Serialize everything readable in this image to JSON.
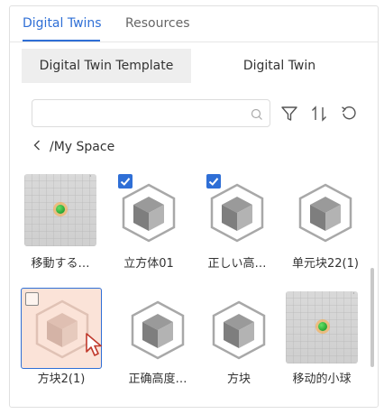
{
  "tabs": [
    {
      "label": "Digital Twins",
      "active": true
    },
    {
      "label": "Resources",
      "active": false
    }
  ],
  "segments": [
    {
      "label": "Digital Twin Template",
      "active": true
    },
    {
      "label": "Digital Twin",
      "active": false
    }
  ],
  "search": {
    "value": "",
    "placeholder": ""
  },
  "toolbar": {
    "icons": [
      "filter-icon",
      "sort-icon",
      "refresh-icon"
    ]
  },
  "breadcrumb": {
    "path": "/My Space"
  },
  "items": [
    {
      "label": "移動する…",
      "thumbnail": "sphere-scene",
      "checked": false
    },
    {
      "label": "立方体01",
      "thumbnail": "cube-icon",
      "checked": true
    },
    {
      "label": "正しい高…",
      "thumbnail": "cube-icon",
      "checked": true
    },
    {
      "label": "单元块22(1)",
      "thumbnail": "cube-icon",
      "checked": false
    },
    {
      "label": "方块2(1)",
      "thumbnail": "cube-icon",
      "checked": false,
      "selected": true
    },
    {
      "label": "正确高度…",
      "thumbnail": "cube-icon",
      "checked": false
    },
    {
      "label": "方块",
      "thumbnail": "cube-icon",
      "checked": false
    },
    {
      "label": "移动的小球",
      "thumbnail": "sphere-scene",
      "checked": false
    }
  ],
  "colors": {
    "accent": "#2f6fd6",
    "selected_bg": "#fbe3d8",
    "segment_active_bg": "#eeeeee"
  }
}
